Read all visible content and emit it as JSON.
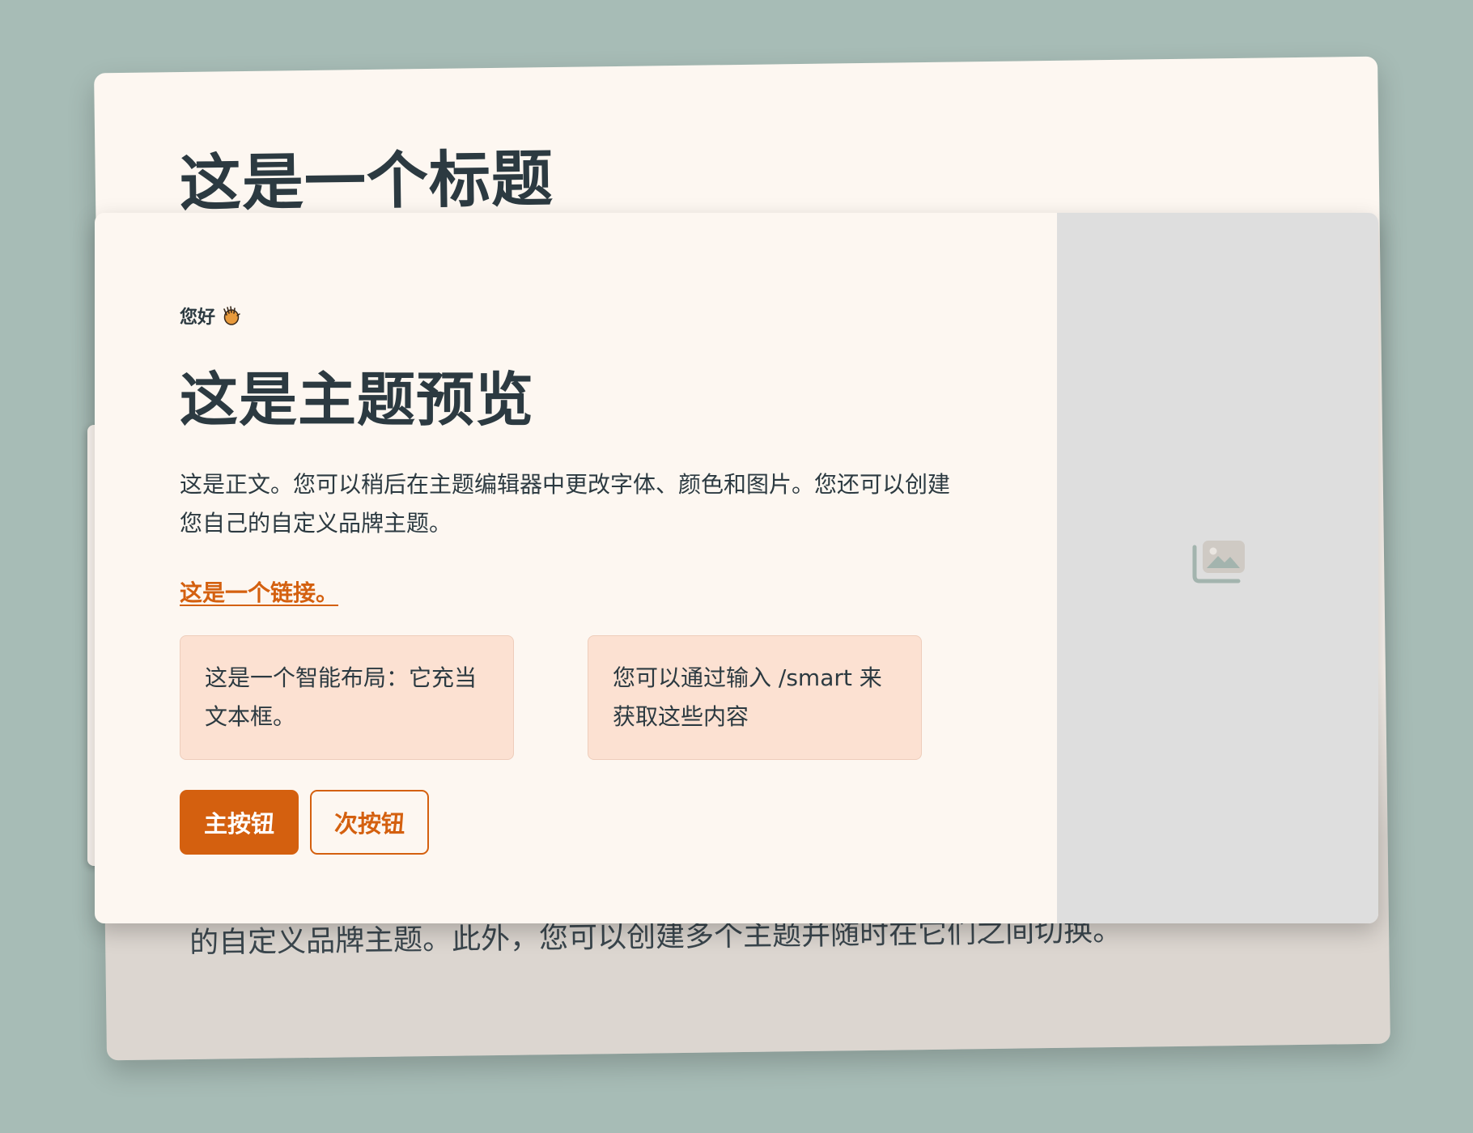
{
  "background_card": {
    "title": "这是一个标题",
    "body_visible_line": "的自定义品牌主题。此外，您可以创建多个主题并随时在它们之间切换。"
  },
  "preview_card": {
    "eyebrow": "您好",
    "eyebrow_icon": "waving-hand-icon",
    "heading": "这是主题预览",
    "paragraph": "这是正文。您可以稍后在主题编辑器中更改字体、颜色和图片。您还可以创建您自己的自定义品牌主题。",
    "link": "这是一个链接。",
    "smart_layout": [
      {
        "text": "这是一个智能布局：它充当文本框。"
      },
      {
        "text": "您可以通过输入 /smart 来获取这些内容"
      }
    ],
    "primary_button": "主按钮",
    "secondary_button": "次按钮",
    "image_placeholder_icon": "image-gallery-icon"
  },
  "colors": {
    "page_background": "#a7bcb6",
    "card_background": "#fdf7f1",
    "accent": "#d4600f",
    "smart_layout_fill": "#fce1d2",
    "image_placeholder": "#dedede",
    "text": "#2c3a41"
  }
}
